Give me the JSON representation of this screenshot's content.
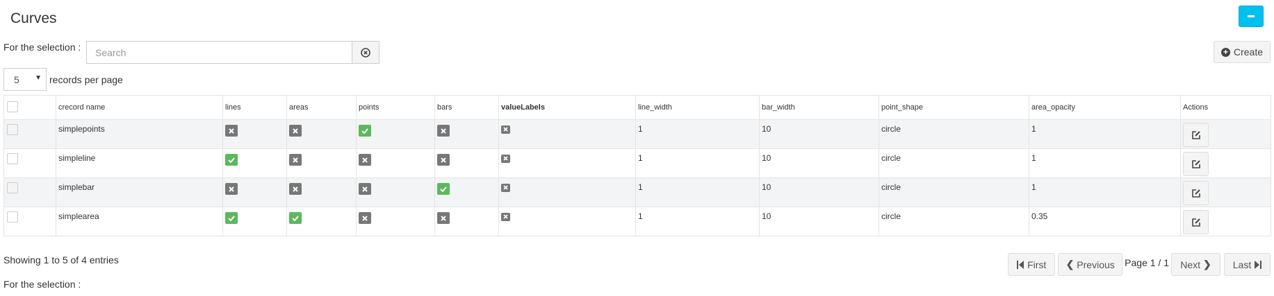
{
  "panel": {
    "title": "Curves"
  },
  "toolbar": {
    "selection_label": "For the selection :",
    "search_placeholder": "Search",
    "create_label": "Create"
  },
  "records_per_page": {
    "value": "5",
    "label": "records per page"
  },
  "table": {
    "columns": [
      "crecord name",
      "lines",
      "areas",
      "points",
      "bars",
      "valueLabels",
      "line_width",
      "bar_width",
      "point_shape",
      "area_opacity",
      "Actions"
    ],
    "rows": [
      {
        "name": "simplepoints",
        "lines": false,
        "areas": false,
        "points": true,
        "bars": false,
        "valueLabels": false,
        "line_width": "1",
        "bar_width": "10",
        "point_shape": "circle",
        "area_opacity": "1"
      },
      {
        "name": "simpleline",
        "lines": true,
        "areas": false,
        "points": false,
        "bars": false,
        "valueLabels": false,
        "line_width": "1",
        "bar_width": "10",
        "point_shape": "circle",
        "area_opacity": "1"
      },
      {
        "name": "simplebar",
        "lines": false,
        "areas": false,
        "points": false,
        "bars": true,
        "valueLabels": false,
        "line_width": "1",
        "bar_width": "10",
        "point_shape": "circle",
        "area_opacity": "1"
      },
      {
        "name": "simplearea",
        "lines": true,
        "areas": true,
        "points": false,
        "bars": false,
        "valueLabels": false,
        "line_width": "1",
        "bar_width": "10",
        "point_shape": "circle",
        "area_opacity": "0.35"
      }
    ]
  },
  "footer": {
    "showing": "Showing 1 to 5 of 4 entries",
    "first": "First",
    "previous": "Previous",
    "page_info": "Page 1 / 1",
    "next": "Next",
    "last": "Last",
    "selection_label": "For the selection :"
  },
  "colors": {
    "accent": "#00c0ef",
    "true_badge": "#5cb85c",
    "false_badge": "#777777"
  }
}
